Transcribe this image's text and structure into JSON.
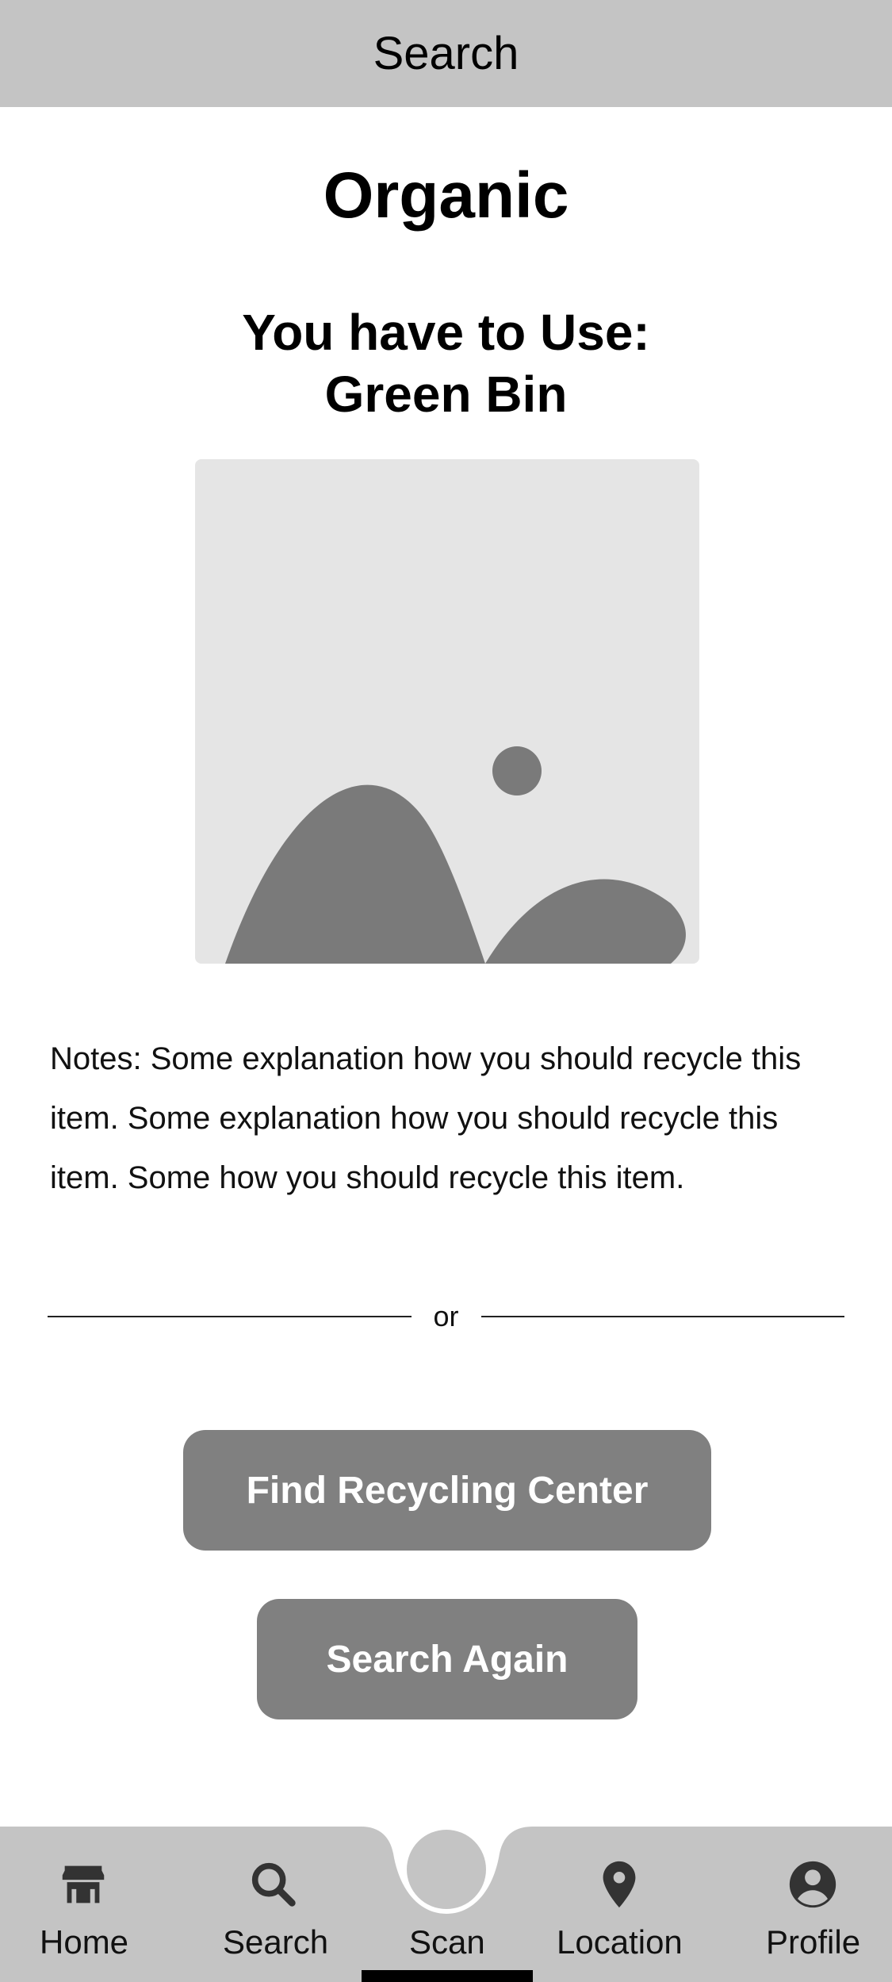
{
  "header": {
    "title": "Search"
  },
  "result": {
    "category": "Organic",
    "instruction_line1": "You have to Use:",
    "instruction_line2": "Green Bin",
    "image_icon": "image-placeholder-icon",
    "notes": "Notes: Some explanation how you should recycle this item. Some explanation how you should recycle this item. Some how you should recycle this item."
  },
  "divider": {
    "label": "or"
  },
  "actions": {
    "find_center": "Find Recycling Center",
    "search_again": "Search Again"
  },
  "nav": {
    "items": [
      {
        "label": "Home",
        "icon": "store-icon"
      },
      {
        "label": "Search",
        "icon": "search-icon"
      },
      {
        "label": "Scan",
        "icon": "scan-circle-icon"
      },
      {
        "label": "Location",
        "icon": "location-pin-icon"
      },
      {
        "label": "Profile",
        "icon": "account-circle-icon"
      }
    ]
  },
  "colors": {
    "bar_background": "#c4c4c4",
    "button_background": "#808080",
    "placeholder_background": "#e5e5e5",
    "placeholder_shapes": "#7a7a7a"
  }
}
